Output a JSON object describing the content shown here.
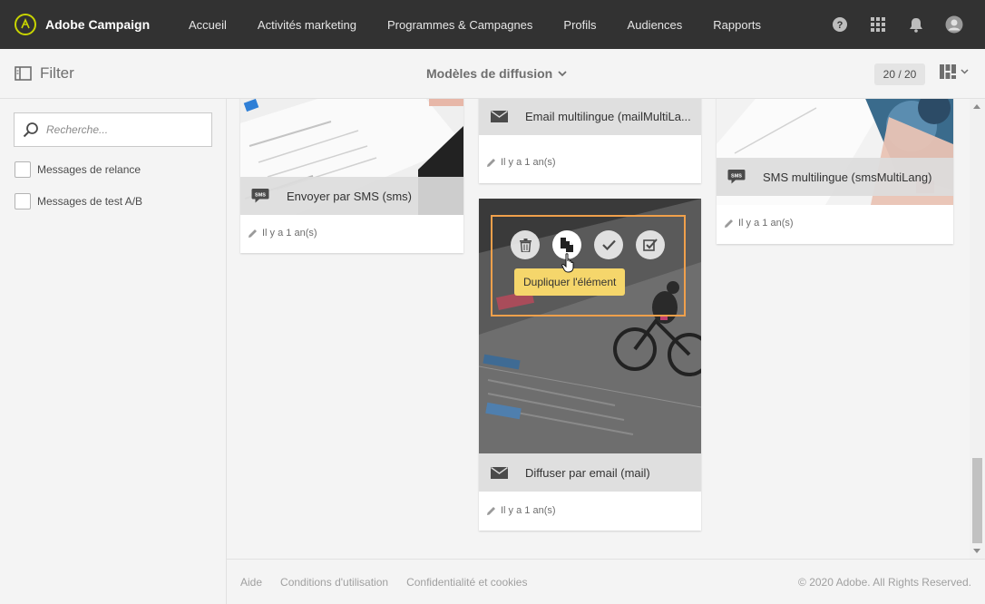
{
  "app": {
    "name": "Adobe Campaign"
  },
  "nav": {
    "items": [
      {
        "label": "Accueil"
      },
      {
        "label": "Activités marketing"
      },
      {
        "label": "Programmes & Campagnes"
      },
      {
        "label": "Profils"
      },
      {
        "label": "Audiences"
      },
      {
        "label": "Rapports"
      }
    ],
    "icons": [
      "help-icon",
      "apps-grid-icon",
      "notifications-bell-icon",
      "user-avatar-icon"
    ]
  },
  "toolbar": {
    "filter_label": "Filter",
    "title": "Modèles de diffusion",
    "count": "20 / 20",
    "view_icon": "card-view-icon"
  },
  "sidebar": {
    "search_placeholder": "Recherche...",
    "facets": [
      {
        "label": "Messages de relance",
        "checked": false
      },
      {
        "label": "Messages de test A/B",
        "checked": false
      }
    ]
  },
  "cards": [
    {
      "title": "Envoyer par SMS (sms)",
      "type_icon": "sms-icon",
      "modified": "Il y a 1 an(s)"
    },
    {
      "title": "Email multilingue (mailMultiLa...",
      "type_icon": "email-icon",
      "modified": "Il y a 1 an(s)"
    },
    {
      "title": "SMS multilingue (smsMultiLang)",
      "type_icon": "sms-icon",
      "modified": "Il y a 1 an(s)"
    },
    {
      "title": "Diffuser par email (mail)",
      "type_icon": "email-icon",
      "modified": "Il y a 1 an(s)"
    }
  ],
  "hover_actions": {
    "buttons": [
      "delete-icon",
      "duplicate-icon",
      "check-icon",
      "select-icon"
    ],
    "tooltip": "Dupliquer l'élément"
  },
  "footer": {
    "links": [
      "Aide",
      "Conditions d'utilisation",
      "Confidentialité et cookies"
    ],
    "copyright": "© 2020 Adobe. All Rights Reserved."
  },
  "colors": {
    "topnav_bg": "#323232",
    "highlight_frame": "#f0a04b",
    "tooltip_bg": "#f5d66b",
    "brand_ring": "#c8d400"
  }
}
